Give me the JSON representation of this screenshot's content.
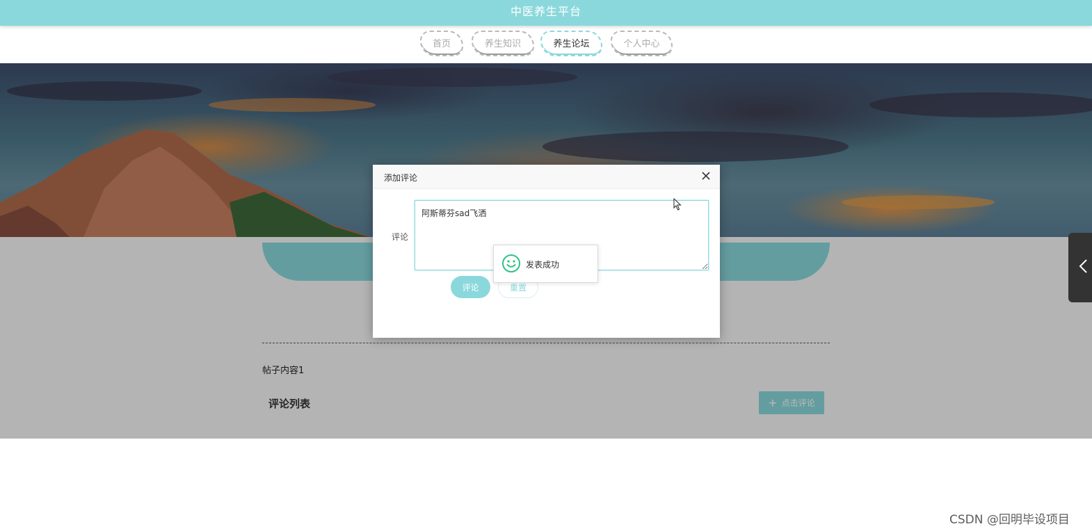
{
  "header": {
    "title": "中医养生平台"
  },
  "nav": {
    "items": [
      {
        "label": "首页",
        "active": false
      },
      {
        "label": "养生知识",
        "active": false
      },
      {
        "label": "养生论坛",
        "active": true
      },
      {
        "label": "个人中心",
        "active": false
      }
    ]
  },
  "post": {
    "content": "帖子内容1",
    "comment_list_title": "评论列表",
    "add_comment_button": "点击评论"
  },
  "dialog": {
    "title": "添加评论",
    "field_label": "评论",
    "textarea_value": "阿斯蒂芬sad飞洒",
    "submit_label": "评论",
    "reset_label": "重置"
  },
  "toast": {
    "message": "发表成功",
    "icon": "smile-icon"
  },
  "watermark": "CSDN @回明毕设项目",
  "colors": {
    "accent": "#8ad8dc",
    "overlay": "rgba(0,0,0,0.27)",
    "sidetab": "#333333"
  }
}
